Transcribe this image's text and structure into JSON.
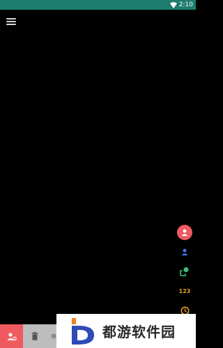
{
  "status_bar": {
    "time": "2:10"
  },
  "right_rail": {
    "items": [
      {
        "icon": "person-icon",
        "active": true
      },
      {
        "icon": "person-outline-icon"
      },
      {
        "icon": "group-icon"
      },
      {
        "label": "123"
      },
      {
        "icon": "clock-icon"
      }
    ]
  },
  "bottom_toolbar": {
    "items": [
      {
        "icon": "person-settings-icon",
        "active": true
      },
      {
        "icon": "trash-icon"
      },
      {
        "icon": "gear-icon"
      }
    ]
  },
  "watermark": {
    "text": "都游软件园"
  },
  "colors": {
    "status_bar": "#1e7d6e",
    "accent": "#ef5a5e",
    "background": "#000000",
    "blue_icon": "#3f7ee8",
    "green_icon": "#3bbf7c",
    "orange_icon": "#e8a020"
  }
}
